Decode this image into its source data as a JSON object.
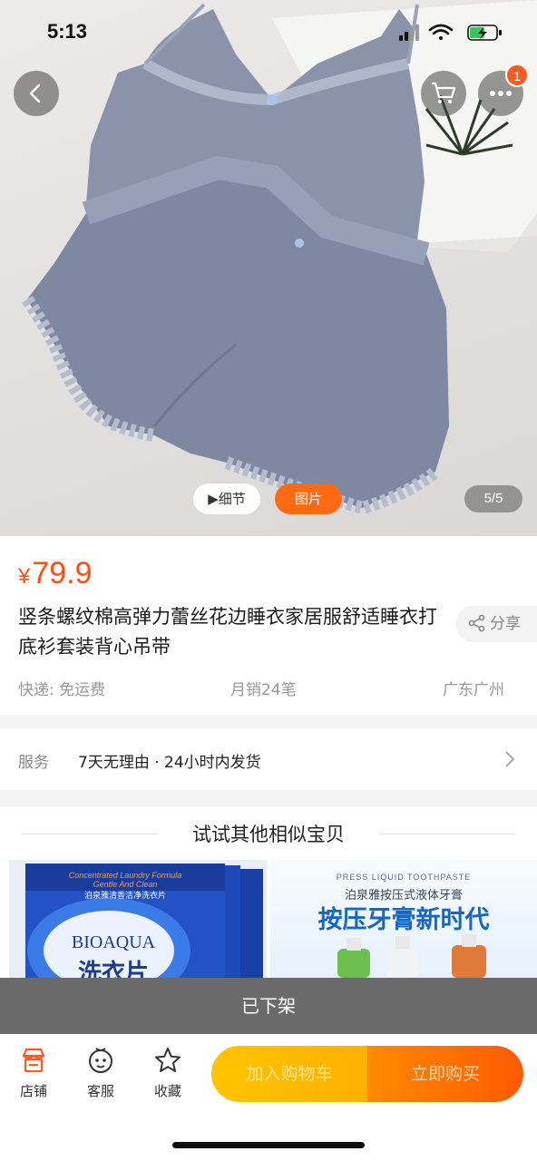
{
  "status_bar": {
    "time": "5:13"
  },
  "top_actions": {
    "cart_badge_count": "1"
  },
  "gallery": {
    "detail_label": "▶细节",
    "picture_label": "图片",
    "counter": "5/5"
  },
  "product": {
    "currency": "¥",
    "price": "79.9",
    "title": "竖条螺纹棉高弹力蕾丝花边睡衣家居服舒适睡衣打底衫套装背心吊带",
    "share_label": "分享",
    "shipping": "快递: 免运费",
    "monthly_sales": "月销24笔",
    "location": "广东广州"
  },
  "service": {
    "label": "服务",
    "value": "7天无理由 · 24小时内发货"
  },
  "similar": {
    "heading": "试试其他相似宝贝",
    "items": [
      {
        "banner_line1": "Concentrated Laundry Formula",
        "banner_line2": "Gentle And Clean",
        "banner_cn": "泊泉雅清香洁净洗衣片",
        "brand": "BIOAQUA",
        "big_text": "洗衣片"
      },
      {
        "small_text": "PRESS LIQUID TOOTHPASTE",
        "sub_text": "泊泉雅按压式液体牙膏",
        "big_text": "按压牙膏新时代"
      }
    ]
  },
  "off_shelf_notice": "已下架",
  "bottom_bar": {
    "store_label": "店铺",
    "service_label": "客服",
    "favorite_label": "收藏",
    "add_to_cart_label": "加入购物车",
    "buy_now_label": "立即购买"
  },
  "colors": {
    "accent_orange": "#ff6a13",
    "price_red": "#ff4e11",
    "cart_yellow": "#ffc400",
    "buy_orange": "#ff6a00"
  }
}
